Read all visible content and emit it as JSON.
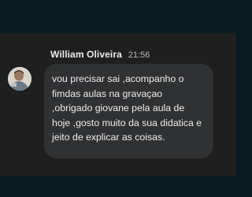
{
  "message": {
    "sender_name": "William Oliveira",
    "time": "21:56",
    "text": "vou precisar sai ,acompanho o\nfimdas aulas na gravaçao\n,obrigado giovane pela aula de\nhoje ,gosto muito da sua didatica e\njeito de explicar as coisas."
  },
  "colors": {
    "background": "#0a1b22",
    "panel": "#1f1f1f",
    "bubble": "#303133",
    "text": "#ececec",
    "timestamp": "#b8b8b8"
  },
  "icons": {
    "avatar": "user-photo-avatar"
  }
}
